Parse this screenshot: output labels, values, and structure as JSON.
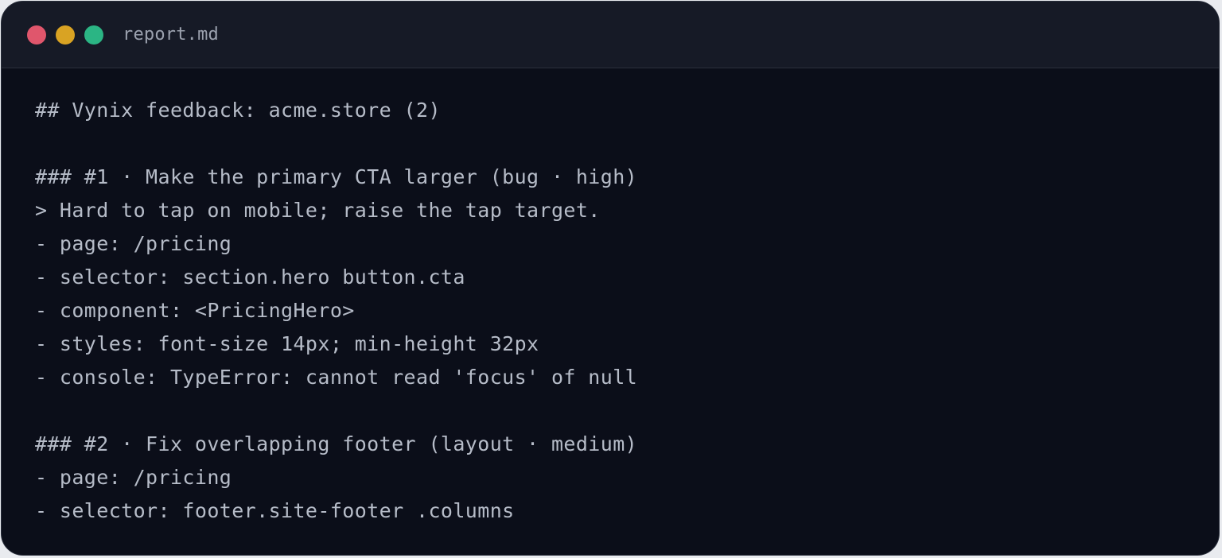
{
  "window": {
    "filename": "report.md",
    "controls": [
      "close",
      "minimize",
      "maximize"
    ]
  },
  "document": {
    "heading": "## Vynix feedback: acme.store (2)",
    "items": [
      {
        "heading": "### #1 · Make the primary CTA larger (bug · high)",
        "quote": "> Hard to tap on mobile; raise the tap target.",
        "fields": [
          "- page: /pricing",
          "- selector: section.hero button.cta",
          "- component: <PricingHero>",
          "- styles: font-size 14px; min-height 32px",
          "- console: TypeError: cannot read 'focus' of null"
        ]
      },
      {
        "heading": "### #2 · Fix overlapping footer (layout · medium)",
        "fields": [
          "- page: /pricing",
          "- selector: footer.site-footer .columns"
        ]
      }
    ]
  },
  "colors": {
    "close": "#e0566c",
    "minimize": "#d9a323",
    "maximize": "#2bb584",
    "background": "#0b0e19",
    "titlebar": "#161a26",
    "text": "#b6bcc8"
  }
}
